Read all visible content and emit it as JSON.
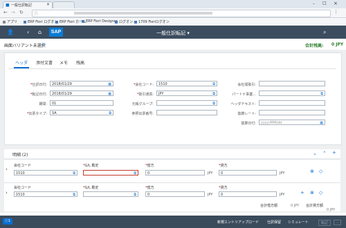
{
  "browser": {
    "tab_title": "一般仕訳転記",
    "url": "",
    "bookmarks": [
      "アプリ",
      "ERP Fiori ログオン",
      "ERP Fiori ホーム",
      "ERP Fiori Designer",
      "ログオン",
      "1709 Fioriログオン"
    ]
  },
  "shell": {
    "logo": "SAP",
    "title": "一般仕訳転記 ▾"
  },
  "header": {
    "variant_label": "画面バリアント未選択",
    "total_label": "合計残高:",
    "total_value": "0 JPY"
  },
  "tabs": [
    "ヘッダ",
    "添付文書",
    "メモ",
    "残高"
  ],
  "form": {
    "posting_date_label": "仕訳日付:",
    "posting_date": "2018/01/29",
    "doc_date_label": "転記日付:",
    "doc_date": "2018/01/29",
    "period_label": "期間:",
    "period": "01",
    "doc_type_label": "伝票タイプ:",
    "doc_type": "SA",
    "company_label": "会社コード:",
    "company": "1510",
    "currency_label": "取引通貨:",
    "currency": "JPY",
    "ledger_group_label": "元帳グループ:",
    "reference_label": "参照伝票番号:",
    "trading_partner_label": "会社間取引:",
    "partner_label": "パートナ事業...",
    "header_text_label": "ヘッダテキスト:",
    "exchange_rate_label": "換算レート:",
    "translation_date_label": "換算日付:",
    "translation_date_placeholder": "yyyy/MM/dd"
  },
  "items": {
    "title": "明細 (2)",
    "col_company": "会社コード",
    "col_gl": "G/L 勘定",
    "col_debit": "借方",
    "col_credit": "貸方",
    "rows": [
      {
        "company": "1510",
        "gl": "",
        "debit": "0",
        "credit": "0",
        "currency": "JPY"
      },
      {
        "company": "1510",
        "gl": "",
        "debit": "0",
        "credit": "0",
        "currency": "JPY"
      }
    ],
    "debit_total_label": "合計借方額",
    "debit_total": "0 JPY",
    "credit_total_label": "合計貸方額",
    "credit_total": "0 JPY"
  },
  "footer": {
    "message_count": "1",
    "buttons": [
      "新規エントリアップロード",
      "仕訳保留",
      "シミュレート",
      "転記"
    ]
  }
}
